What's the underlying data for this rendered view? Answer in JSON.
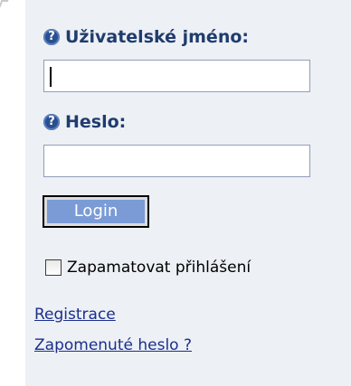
{
  "form": {
    "username_label": "Uživatelské jméno:",
    "username_value": "",
    "password_label": "Heslo:",
    "password_value": "",
    "login_button": "Login",
    "remember_label": "Zapamatovat přihlášení",
    "remember_checked": false,
    "help_glyph": "?"
  },
  "links": {
    "register": "Registrace",
    "forgot_password": "Zapomenuté heslo ?"
  },
  "colors": {
    "panel_background": "#edf0f5",
    "label_text": "#1f3c6e",
    "button_face": "#7a9bd6",
    "link_text": "#1a2f8c"
  },
  "icons": {
    "help": "help-question-icon"
  }
}
